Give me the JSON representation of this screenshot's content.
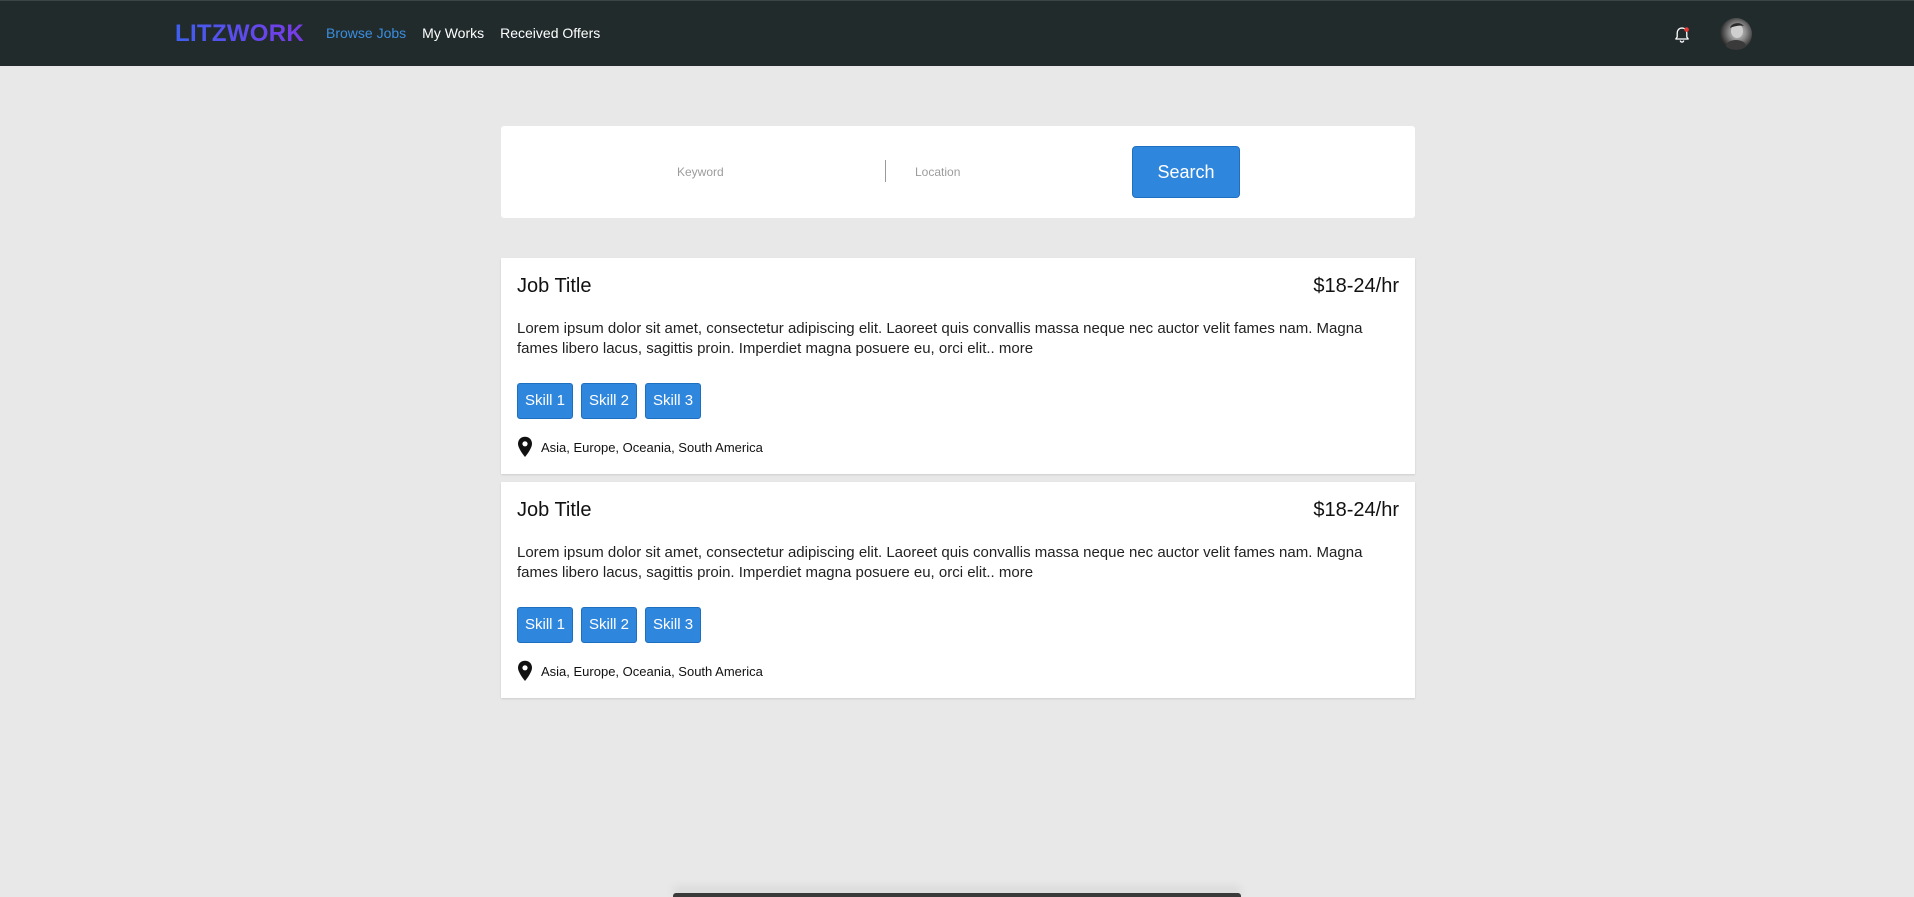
{
  "nav": {
    "logo": "LITZWORK",
    "links": [
      {
        "label": "Browse Jobs",
        "active": true
      },
      {
        "label": "My Works",
        "active": false
      },
      {
        "label": "Received Offers",
        "active": false
      }
    ],
    "notification_icon": "bell-icon",
    "avatar_icon": "user-avatar"
  },
  "search": {
    "keyword_placeholder": "Keyword",
    "keyword_value": "",
    "location_placeholder": "Location",
    "location_value": "",
    "button_label": "Search"
  },
  "jobs": [
    {
      "title": "Job Title",
      "rate": "$18-24/hr",
      "description": "Lorem ipsum dolor sit amet, consectetur adipiscing elit. Laoreet quis convallis massa neque nec auctor velit fames nam. Magna fames libero lacus, sagittis proin. Imperdiet magna posuere eu, orci elit..",
      "more_label": "more",
      "skills": [
        "Skill 1",
        "Skill 2",
        "Skill 3"
      ],
      "location": "Asia, Europe, Oceania, South America",
      "location_icon": "map-pin-icon"
    },
    {
      "title": "Job Title",
      "rate": "$18-24/hr",
      "description": "Lorem ipsum dolor sit amet, consectetur adipiscing elit. Laoreet quis convallis massa neque nec auctor velit fames nam. Magna fames libero lacus, sagittis proin. Imperdiet magna posuere eu, orci elit..",
      "more_label": "more",
      "skills": [
        "Skill 1",
        "Skill 2",
        "Skill 3"
      ],
      "location": "Asia, Europe, Oceania, South America",
      "location_icon": "map-pin-icon"
    }
  ],
  "colors": {
    "navbar_bg": "#212b2c",
    "page_bg": "#e8e8e8",
    "accent": "#2f86dd",
    "active_link": "#3a8ee0",
    "logo_gradient": [
      "#3f5ff0",
      "#7a3ae8"
    ],
    "notification_dot": "#e53935"
  }
}
